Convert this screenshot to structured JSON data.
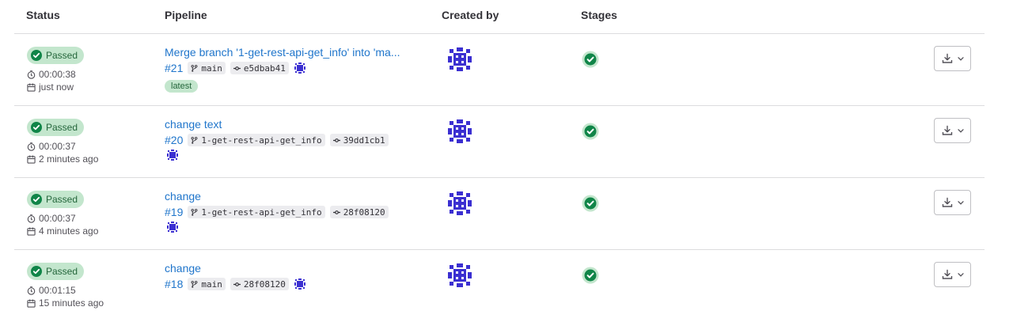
{
  "headers": {
    "status": "Status",
    "pipeline": "Pipeline",
    "created_by": "Created by",
    "stages": "Stages"
  },
  "pipelines": [
    {
      "status": "Passed",
      "duration": "00:00:38",
      "finished": "just now",
      "title": "Merge branch '1-get-rest-api-get_info' into 'ma...",
      "id": "#21",
      "branch": "main",
      "commit": "e5dbab41",
      "tag": "latest"
    },
    {
      "status": "Passed",
      "duration": "00:00:37",
      "finished": "2 minutes ago",
      "title": "change text",
      "id": "#20",
      "branch": "1-get-rest-api-get_info",
      "commit": "39dd1cb1"
    },
    {
      "status": "Passed",
      "duration": "00:00:37",
      "finished": "4 minutes ago",
      "title": "change",
      "id": "#19",
      "branch": "1-get-rest-api-get_info",
      "commit": "28f08120"
    },
    {
      "status": "Passed",
      "duration": "00:01:15",
      "finished": "15 minutes ago",
      "title": "change",
      "id": "#18",
      "branch": "main",
      "commit": "28f08120"
    }
  ],
  "icons": {
    "status": "check-circle-icon",
    "duration": "clock-icon",
    "finished": "calendar-icon",
    "branch": "branch-icon",
    "commit": "commit-icon",
    "avatar": "identicon-avatar",
    "stage": "stage-success-icon",
    "download": "download-icon",
    "dropdown": "chevron-down-icon"
  },
  "colors": {
    "link": "#1f75cb",
    "success_bg": "#c3e6cd",
    "success_text": "#24663b",
    "success_icon": "#108548",
    "avatar": "#3b2fd1"
  }
}
